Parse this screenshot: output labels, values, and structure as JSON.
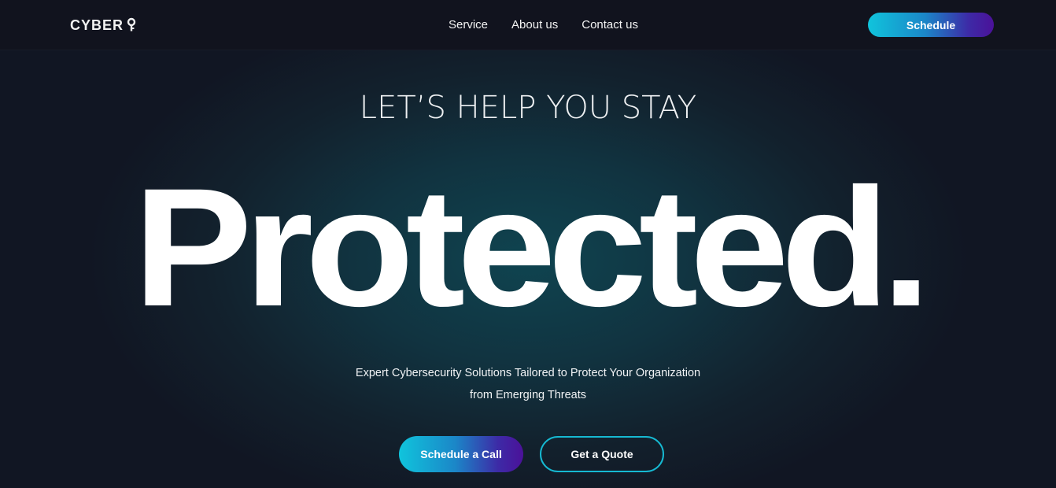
{
  "brand": {
    "logo_text": "CYBER",
    "logo_icon": "key-icon"
  },
  "nav": {
    "links": [
      {
        "label": "Service"
      },
      {
        "label": "About us"
      },
      {
        "label": "Contact us"
      }
    ],
    "schedule_label": "Schedule"
  },
  "hero": {
    "kicker": "LET’S HELP YOU STAY",
    "title": "Protected.",
    "subtitle_line1": "Expert Cybersecurity Solutions Tailored to Protect Your Organization",
    "subtitle_line2": "from Emerging Threats",
    "cta_primary": "Schedule a Call",
    "cta_secondary": "Get a Quote"
  },
  "colors": {
    "background": "#111420",
    "glow": "#0f4450",
    "gradient_start": "#10c4dc",
    "gradient_end": "#4b1199",
    "outline_accent": "#16b9d2"
  }
}
